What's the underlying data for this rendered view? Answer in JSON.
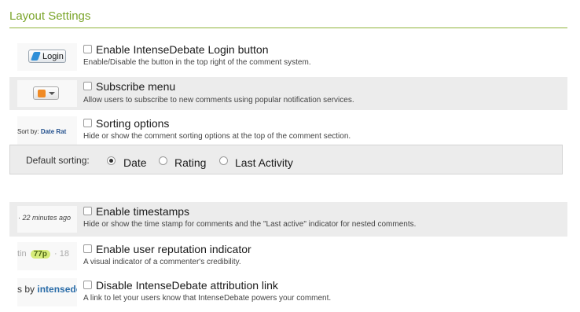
{
  "section": {
    "title": "Layout Settings"
  },
  "options": [
    {
      "label": "Enable IntenseDebate Login button",
      "description": "Enable/Disable the button in the top right of the comment system.",
      "checked": false,
      "thumb_text": "Login"
    },
    {
      "label": "Subscribe menu",
      "description": "Allow users to subscribe to new comments using popular notification services.",
      "checked": false
    },
    {
      "label": "Sorting options",
      "description": "Hide or show the comment sorting options at the top of the comment section.",
      "checked": false,
      "thumb_text": {
        "prefix": "Sort by:",
        "date": "Date",
        "rating": "Rat"
      }
    },
    {
      "label": "Enable timestamps",
      "description": "Hide or show the time stamp for comments and the \"Last active\" indicator for nested comments.",
      "checked": false,
      "thumb_text": "· 22 minutes ago"
    },
    {
      "label": "Enable user reputation indicator",
      "description": "A visual indicator of a commenter's credibility.",
      "checked": false,
      "thumb_text": {
        "before": "tin",
        "pill": "77p",
        "after": "· 18"
      }
    },
    {
      "label": "Disable IntenseDebate attribution link",
      "description": "A link to let your users know that IntenseDebate powers your comment.",
      "checked": false,
      "thumb_text": {
        "before": "s by",
        "brand": "intensede"
      }
    }
  ],
  "default_sorting": {
    "label": "Default sorting:",
    "options": [
      "Date",
      "Rating",
      "Last Activity"
    ],
    "selected": "Date"
  },
  "colors": {
    "accent": "#7ba52b",
    "row_shade": "#ececec"
  }
}
